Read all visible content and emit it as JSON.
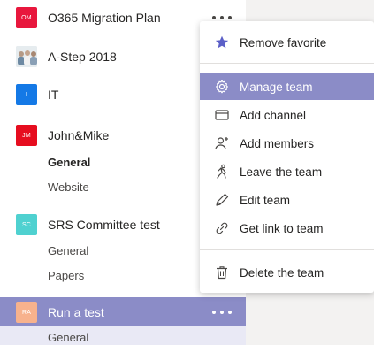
{
  "teams": [
    {
      "name": "O365 Migration Plan",
      "avatar_text": "OM",
      "avatar_color": "#e8173d",
      "more_visible": true
    },
    {
      "name": "A-Step 2018",
      "avatar_text": "",
      "avatar_color": "#c9d3da",
      "more_visible": false
    },
    {
      "name": "IT",
      "avatar_text": "I",
      "avatar_color": "#1479e6",
      "more_visible": false
    },
    {
      "name": "John&Mike",
      "avatar_text": "JM",
      "avatar_color": "#e60d1f",
      "more_visible": false,
      "channels": [
        "General",
        "Website"
      ]
    },
    {
      "name": "SRS Committee test",
      "avatar_text": "SC",
      "avatar_color": "#4fd1d0",
      "more_visible": false,
      "channels": [
        "General",
        "Papers"
      ]
    },
    {
      "name": "Run a test",
      "avatar_text": "RA",
      "avatar_color": "#f7b28d",
      "more_visible": true,
      "active": true,
      "channels": [
        "General"
      ]
    }
  ],
  "context_menu": {
    "items": [
      {
        "label": "Remove favorite",
        "icon": "star-icon"
      },
      {
        "label": "Manage team",
        "icon": "gear-icon",
        "highlighted": true
      },
      {
        "label": "Add channel",
        "icon": "channel-icon"
      },
      {
        "label": "Add members",
        "icon": "add-person-icon"
      },
      {
        "label": "Leave the team",
        "icon": "leave-icon"
      },
      {
        "label": "Edit team",
        "icon": "pencil-icon"
      },
      {
        "label": "Get link to team",
        "icon": "link-icon"
      },
      {
        "label": "Delete the team",
        "icon": "trash-icon"
      }
    ]
  },
  "colors": {
    "accent": "#8b8cc7",
    "accent_light": "#e9e9f5",
    "star": "#5b5fc7"
  }
}
